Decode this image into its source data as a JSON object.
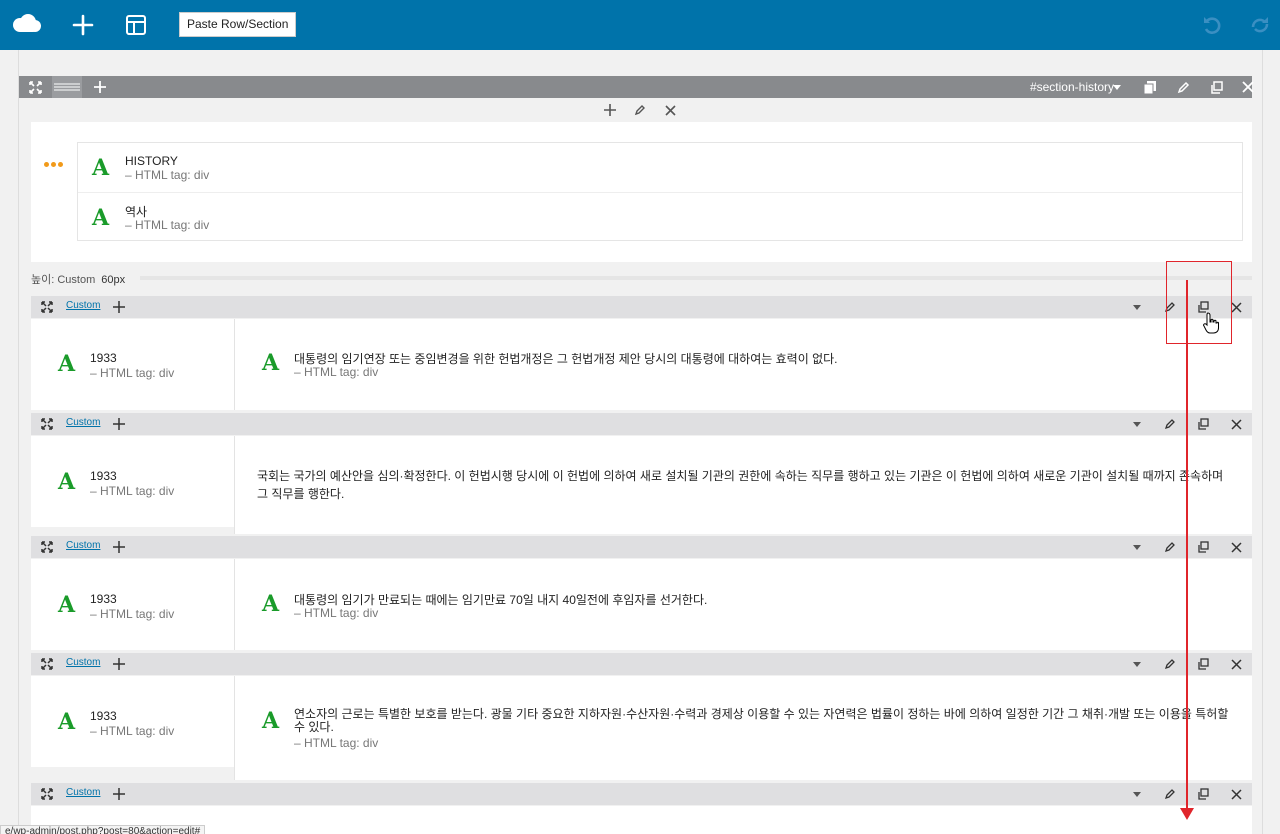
{
  "toolbar": {
    "paste_label": "Paste Row/Section",
    "icons": [
      "logo-cloud-icon",
      "plus-icon",
      "layout-icon",
      "undo-icon",
      "redo-icon"
    ]
  },
  "section": {
    "anchor": "#section-history",
    "modules": [
      {
        "title": "HISTORY",
        "subtitle": "– HTML tag: div"
      },
      {
        "title": "역사",
        "subtitle": "– HTML tag: div"
      }
    ],
    "height_label": "높이: Custom",
    "height_value": "60px"
  },
  "rows": [
    {
      "custom": "Custom",
      "left": {
        "title": "1933",
        "subtitle": "– HTML tag: div"
      },
      "right": {
        "type": "module",
        "title": "대통령의 임기연장 또는 중임변경을 위한 헌법개정은 그 헌법개정 제안 당시의 대통령에 대하여는 효력이 없다.",
        "subtitle": "– HTML tag: div"
      }
    },
    {
      "custom": "Custom",
      "left": {
        "title": "1933",
        "subtitle": "– HTML tag: div"
      },
      "right": {
        "type": "text",
        "text": "국회는 국가의 예산안을 심의·확정한다. 이 헌법시행 당시에 이 헌법에 의하여 새로 설치될 기관의 권한에 속하는 직무를 행하고 있는 기관은 이 헌법에 의하여 새로운 기관이 설치될 때까지 존속하며 그 직무를 행한다."
      }
    },
    {
      "custom": "Custom",
      "left": {
        "title": "1933",
        "subtitle": "– HTML tag: div"
      },
      "right": {
        "type": "module",
        "title": "대통령의 임기가 만료되는 때에는 임기만료 70일 내지 40일전에 후임자를 선거한다.",
        "subtitle": "– HTML tag: div"
      }
    },
    {
      "custom": "Custom",
      "left": {
        "title": "1933",
        "subtitle": "– HTML tag: div"
      },
      "right": {
        "type": "module",
        "title": "연소자의 근로는 특별한 보호를 받는다. 광물 기타 중요한 지하자원·수산자원·수력과 경제상 이용할 수 있는 자연력은 법률이 정하는 바에 의하여 일정한 기간 그 채취·개발 또는 이용을 특허할 수 있다.",
        "subtitle": "– HTML tag: div"
      }
    },
    {
      "custom": "Custom"
    }
  ],
  "status_url": "e/wp-admin/post.php?post=80&action=edit#"
}
